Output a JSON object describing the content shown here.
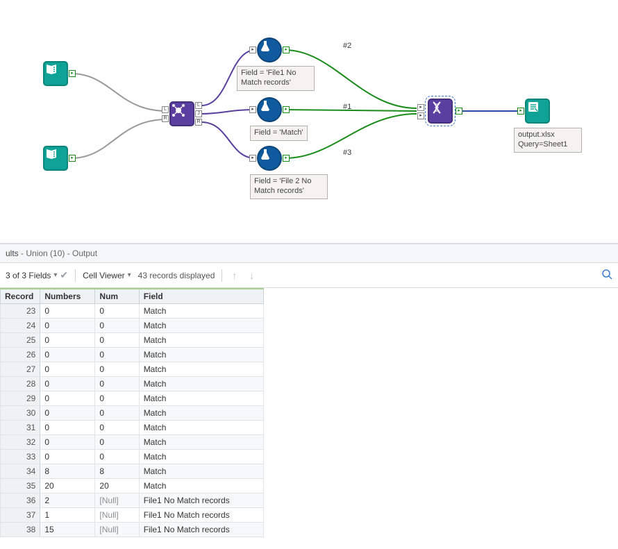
{
  "canvas": {
    "labels": {
      "l2": "#2",
      "l1": "#1",
      "l3": "#3"
    },
    "notes": {
      "n_top": "Field = 'File1 No Match records'",
      "n_mid": "Field = 'Match'",
      "n_bot": "Field = 'File 2 No Match records'"
    },
    "output": {
      "line1": "output.xlsx",
      "line2": "Query=Sheet1"
    },
    "join_ports": {
      "l_in": "L",
      "r_in": "R",
      "l_out": "L",
      "j_out": "J",
      "r_out": "R"
    }
  },
  "results": {
    "header_suffix": " - Union (10) - Output",
    "toolbar": {
      "fields_label": "3 of 3 Fields",
      "cellviewer": "Cell Viewer",
      "records": "43 records displayed"
    },
    "columns": [
      "Record",
      "Numbers",
      "Num",
      "Field"
    ],
    "rows": [
      {
        "rec": 23,
        "numbers": "0",
        "num": "0",
        "field": "Match"
      },
      {
        "rec": 24,
        "numbers": "0",
        "num": "0",
        "field": "Match"
      },
      {
        "rec": 25,
        "numbers": "0",
        "num": "0",
        "field": "Match"
      },
      {
        "rec": 26,
        "numbers": "0",
        "num": "0",
        "field": "Match"
      },
      {
        "rec": 27,
        "numbers": "0",
        "num": "0",
        "field": "Match"
      },
      {
        "rec": 28,
        "numbers": "0",
        "num": "0",
        "field": "Match"
      },
      {
        "rec": 29,
        "numbers": "0",
        "num": "0",
        "field": "Match"
      },
      {
        "rec": 30,
        "numbers": "0",
        "num": "0",
        "field": "Match"
      },
      {
        "rec": 31,
        "numbers": "0",
        "num": "0",
        "field": "Match"
      },
      {
        "rec": 32,
        "numbers": "0",
        "num": "0",
        "field": "Match"
      },
      {
        "rec": 33,
        "numbers": "0",
        "num": "0",
        "field": "Match"
      },
      {
        "rec": 34,
        "numbers": "8",
        "num": "8",
        "field": "Match"
      },
      {
        "rec": 35,
        "numbers": "20",
        "num": "20",
        "field": "Match"
      },
      {
        "rec": 36,
        "numbers": "2",
        "num": "[Null]",
        "field": "File1 No Match records"
      },
      {
        "rec": 37,
        "numbers": "1",
        "num": "[Null]",
        "field": "File1 No Match records"
      },
      {
        "rec": 38,
        "numbers": "15",
        "num": "[Null]",
        "field": "File1 No Match records"
      }
    ]
  }
}
